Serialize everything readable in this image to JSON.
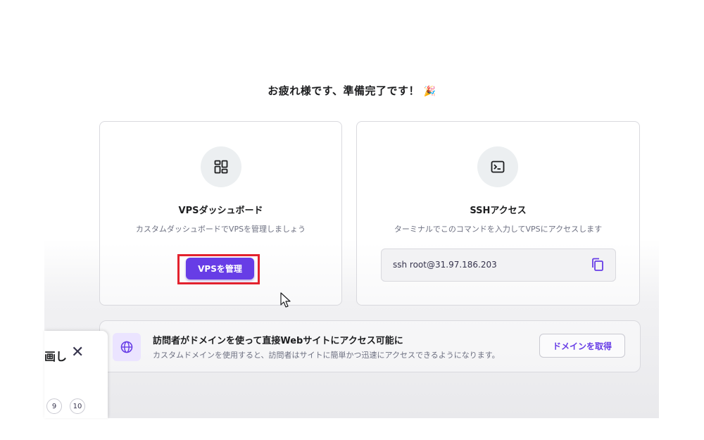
{
  "headline": "お疲れ様です、準備完了です！",
  "party_emoji": "🎉",
  "dashboard_card": {
    "icon": "dashboard-grid-icon",
    "title": "VPSダッシュボード",
    "description": "カスタムダッシュボードでVPSを管理しましょう",
    "button_label": "VPSを管理"
  },
  "ssh_card": {
    "icon": "terminal-icon",
    "title": "SSHアクセス",
    "description": "ターミナルでこのコマンドを入力してVPSにアクセスします",
    "command": "ssh root@31.97.186.203",
    "copy_icon": "copy-icon"
  },
  "domain_banner": {
    "icon": "globe-icon",
    "title": "訪問者がドメインを使って直接Webサイトにアクセス可能に",
    "description": "カスタムドメインを使用すると、訪問者はサイトに簡単かつ迅速にアクセスできるようになります。",
    "button_label": "ドメインを取得"
  },
  "side_panel": {
    "title_fragment": "画し",
    "close_icon": "close-icon",
    "pages": [
      "9",
      "10"
    ]
  },
  "colors": {
    "accent": "#673de6",
    "highlight": "#e3222e"
  }
}
